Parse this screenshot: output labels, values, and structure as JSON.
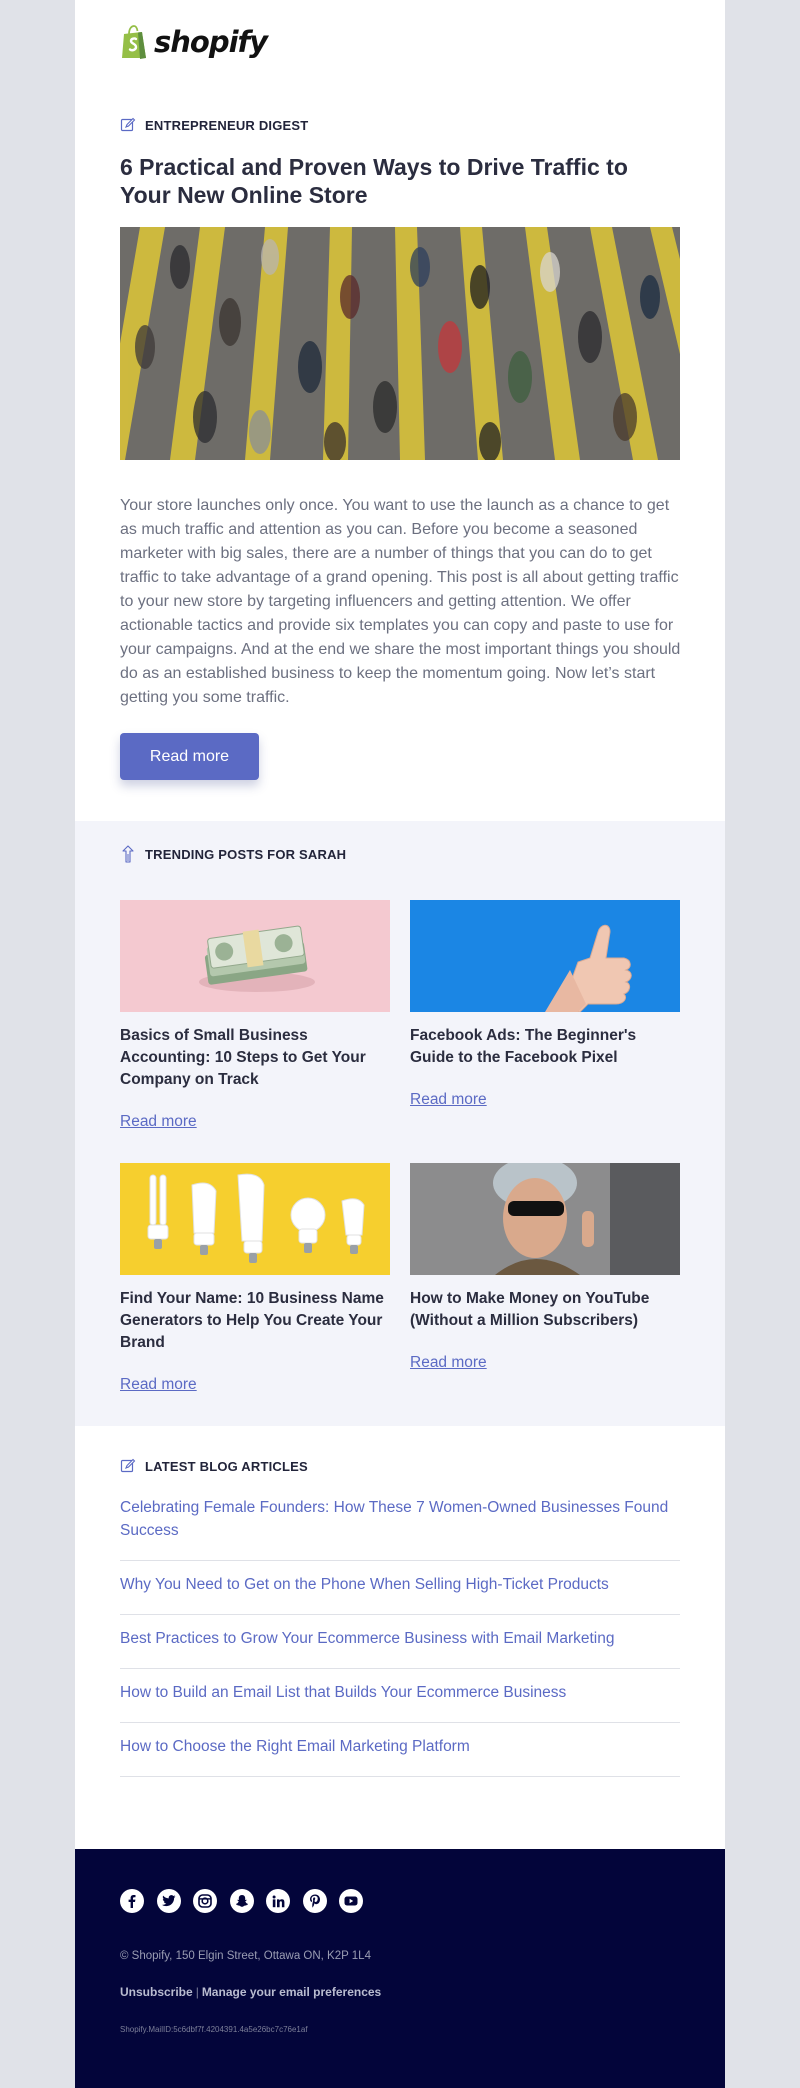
{
  "brand": {
    "name": "shopify"
  },
  "digest": {
    "section_label": "ENTREPRENEUR DIGEST",
    "title": "6 Practical and Proven Ways to Drive Traffic to Your New Online Store",
    "body": "Your store launches only once. You want to use the launch as a chance to get as much traffic and attention as you can. Before you become a seasoned marketer with big sales, there are a number of things that you can do to get traffic to take advantage of a grand opening. This post is all about getting traffic to your new store by targeting influencers and getting attention. We offer actionable tactics and provide six templates you can copy and paste to use for your campaigns. And at the end we share the most important things you should do as an established business to keep the momentum going. Now let’s start getting you some traffic.",
    "button_label": "Read more"
  },
  "trending": {
    "section_label": "TRENDING POSTS FOR SARAH",
    "cards": [
      {
        "title": "Basics of Small Business Accounting: 10 Steps to Get Your Company on Track",
        "link": "Read more",
        "image": "cash-stack-on-pink"
      },
      {
        "title": "Facebook Ads: The Beginner's Guide to the Facebook Pixel",
        "link": "Read more",
        "image": "thumbs-up-on-blue"
      },
      {
        "title": "Find Your Name: 10 Business Name Generators to Help You Create Your Brand",
        "link": "Read more",
        "image": "light-bulbs-on-yellow"
      },
      {
        "title": "How to Make Money on YouTube (Without a Million Subscribers)",
        "link": "Read more",
        "image": "woman-sunglasses"
      }
    ]
  },
  "latest": {
    "section_label": "LATEST BLOG ARTICLES",
    "items": [
      "Celebrating Female Founders: How These 7 Women-Owned Businesses Found Success",
      "Why You Need to Get on the Phone When Selling High-Ticket Products",
      "Best Practices to Grow Your Ecommerce Business with Email Marketing",
      "How to Build an Email List that Builds Your Ecommerce Business",
      "How to Choose the Right Email Marketing Platform"
    ]
  },
  "footer": {
    "social": [
      "facebook-icon",
      "twitter-icon",
      "instagram-icon",
      "snapchat-icon",
      "linkedin-icon",
      "pinterest-icon",
      "youtube-icon"
    ],
    "address": "© Shopify,  150 Elgin Street, Ottawa ON, K2P 1L4",
    "unsubscribe": "Unsubscribe",
    "separator": "|",
    "preferences": "Manage your email preferences",
    "mail_id": "Shopify.MailID:5c6dbf7f.4204391.4a5e26bc7c76e1af"
  },
  "colors": {
    "accent": "#5b6ac4",
    "footer_bg": "#03053a",
    "page_bg": "#e0e2e8",
    "trending_bg": "#f3f4fa",
    "shopify_green": "#95bf47"
  }
}
